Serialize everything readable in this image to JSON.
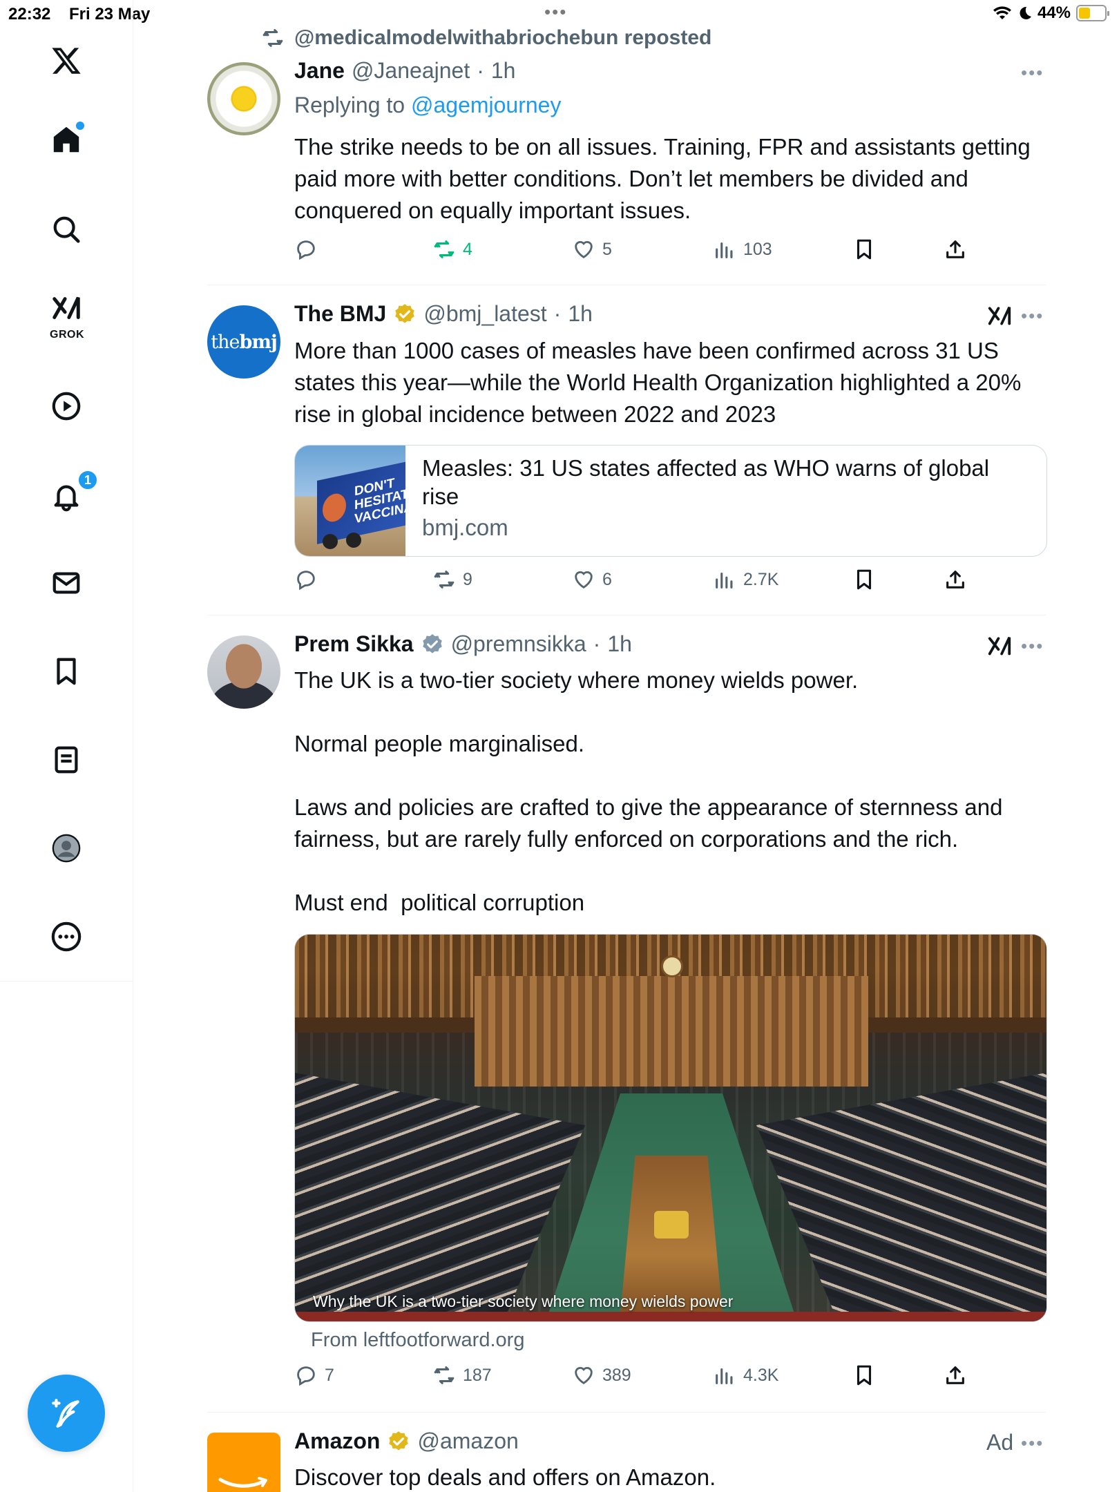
{
  "status_bar": {
    "time": "22:32",
    "date": "Fri 23 May",
    "battery": "44%",
    "battery_level": 0.44
  },
  "sidebar": {
    "items": [
      {
        "name": "home",
        "icon": "home-icon"
      },
      {
        "name": "search",
        "icon": "search-icon"
      },
      {
        "name": "grok",
        "icon": "grok-icon",
        "label": "GROK"
      },
      {
        "name": "video",
        "icon": "play-icon"
      },
      {
        "name": "notifications",
        "icon": "bell-icon",
        "badge": "1"
      },
      {
        "name": "messages",
        "icon": "mail-icon"
      },
      {
        "name": "bookmarks",
        "icon": "bookmark-icon"
      },
      {
        "name": "lists",
        "icon": "list-icon"
      },
      {
        "name": "profile",
        "icon": "profile-icon"
      },
      {
        "name": "more",
        "icon": "more-icon"
      }
    ],
    "compose_icon": "compose-icon"
  },
  "posts": [
    {
      "repost_context": "@medicalmodelwithabriochebun reposted",
      "name": "Jane",
      "handle": "@Janeajnet",
      "dot": "·",
      "time": "1h",
      "replying_prefix": "Replying to ",
      "replying_to": "@agemjourney",
      "text": "The strike needs to be on all issues. Training, FPR and assistants getting paid more with better conditions. Don’t let members be divided and conquered on equally important issues.",
      "stats": {
        "replies": "",
        "reposts": "4",
        "likes": "5",
        "views": "103"
      }
    },
    {
      "name": "The BMJ",
      "handle": "@bmj_latest",
      "dot": "·",
      "time": "1h",
      "avatar_text_light": "the",
      "avatar_text_bold": "bmj",
      "text": "More than 1000 cases of measles have been confirmed across 31 US states this year—while the World Health Organization highlighted a 20% rise in global incidence between 2022 and 2023",
      "card": {
        "title": "Measles: 31 US states affected as WHO warns of global rise",
        "domain": "bmj.com",
        "thumb_text": "DON'T HESITATE VACCINATE"
      },
      "stats": {
        "replies": "",
        "reposts": "9",
        "likes": "6",
        "views": "2.7K"
      }
    },
    {
      "name": "Prem Sikka",
      "handle": "@premnsikka",
      "dot": "·",
      "time": "1h",
      "text": "The UK is a two-tier society where money wields power.\n\nNormal people marginalised.\n\nLaws and policies are crafted to give the appearance of sternness and fairness, but are rarely fully enforced on corporations and the rich.\n\nMust end  political corruption",
      "media_caption": "Why the UK is a two-tier society where money wields power",
      "media_source": "From leftfootforward.org",
      "stats": {
        "replies": "7",
        "reposts": "187",
        "likes": "389",
        "views": "4.3K"
      }
    },
    {
      "name": "Amazon",
      "handle": "@amazon",
      "ad_label": "Ad",
      "text": "Discover top deals and offers on Amazon."
    }
  ],
  "colors": {
    "accent": "#1d9bf0",
    "repost_green": "#00ba7c",
    "muted": "#536471",
    "verified_gold": "#e2b719"
  }
}
